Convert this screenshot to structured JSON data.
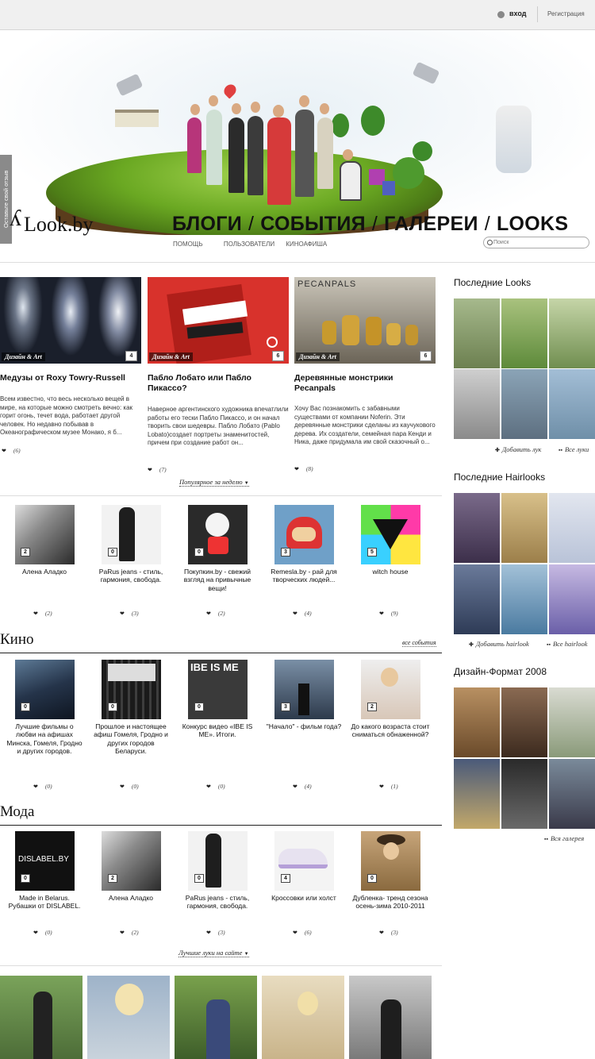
{
  "topbar": {
    "login": "вход",
    "register": "Регистрация"
  },
  "feedback": "Оставьте свой отзыв",
  "logo": "Look.by",
  "nav": {
    "items": [
      "БЛОГИ",
      "СОБЫТИЯ",
      "ГАЛЕРЕИ",
      "LOOKS"
    ],
    "sep": "/"
  },
  "subnav": [
    "ПОМОЩЬ",
    "ПОЛЬЗОВАТЕЛИ",
    "КИНОАФИША"
  ],
  "search": {
    "placeholder": "Поиск"
  },
  "articles": [
    {
      "category": "Дизайн & Art",
      "count": "4",
      "title": "Медузы от Roxy Towry-Russell",
      "text": "Всем известно, что весь несколько вещей в мире, на которые можно смотреть вечно: как горит огонь, течет вода, работает другой человек. Но недавно побывав в Океанографическом музее Монако, я б...",
      "likes": "(6)"
    },
    {
      "category": "Дизайн & Art",
      "count": "6",
      "title": "Пабло Лобато или Пабло Пикассо?",
      "text": "Наверное аргентинского художника впечатлили работы его тески Пабло Пикассо, и он начал творить свои шедевры. Пабло Лобато (Pablo Lobato)создает портреты знаменитостей, причем при создание работ он...",
      "likes": "(7)"
    },
    {
      "category": "Дизайн & Art",
      "count": "6",
      "title": "Деревянные монстрики Pecanpals",
      "text": "Хочу Вас познакомить с забавными существами от компании Noferin. Эти деревянные монстрики сделаны из каучукового дерева. Их создатели, семейная пара Кенди и Ника, даже придумала им свой сказочный о...",
      "likes": "(8)"
    }
  ],
  "popular_link": "Популярное за неделю",
  "blogs": [
    {
      "label": "Алена Аладко",
      "count": "2",
      "likes": "(2)"
    },
    {
      "label": "PaRus jeans - стиль, гармония, свобода.",
      "count": "0",
      "likes": "(3)"
    },
    {
      "label": "Покупкин.by - свежий взгляд на привычные вещи!",
      "count": "0",
      "likes": "(2)"
    },
    {
      "label": "Remesla.by - рай для творческих людей...",
      "count": "3",
      "likes": "(4)"
    },
    {
      "label": "witch house",
      "count": "5",
      "likes": "(9)"
    }
  ],
  "kino": {
    "title": "Кино",
    "link": "все события",
    "items": [
      {
        "label": "Лучшие фильмы о любви на афишах Минска, Гомеля, Гродно и других городов.",
        "count": "0",
        "likes": "(0)"
      },
      {
        "label": "Прошлое и настоящее афиш Гомеля, Гродно и других городов Беларуси.",
        "count": "0",
        "likes": "(0)"
      },
      {
        "label": "Конкурс видео «IBE IS ME». Итоги.",
        "count": "0",
        "likes": "(0)",
        "img_text": "IBE IS ME"
      },
      {
        "label": "\"Начало\" - фильм года?",
        "count": "3",
        "likes": "(4)"
      },
      {
        "label": "До какого возраста стоит сниматься обнаженной?",
        "count": "2",
        "likes": "(1)"
      }
    ]
  },
  "moda": {
    "title": "Мода",
    "items": [
      {
        "label": "Made in Belarus. Рубашки от DISLABEL.",
        "count": "0",
        "likes": "(0)",
        "img_text": "DISLABEL.BY"
      },
      {
        "label": "Алена Аладко",
        "count": "2",
        "likes": "(2)"
      },
      {
        "label": "PaRus jeans - стиль, гармония, свобода.",
        "count": "0",
        "likes": "(3)"
      },
      {
        "label": "Кроссовки или холст",
        "count": "4",
        "likes": "(6)"
      },
      {
        "label": "Дубленка- тренд сезона осень-зима 2010-2011",
        "count": "0",
        "likes": "(3)"
      }
    ]
  },
  "best_looks_link": "Лучшие луки на сайте",
  "sidebar": {
    "looks": {
      "title": "Последние Looks",
      "add": "Добавить лук",
      "all": "Все луки"
    },
    "hairlooks": {
      "title": "Последние Hairlooks",
      "add": "Добавить hairlook",
      "all": "Все hairlook"
    },
    "design": {
      "title": "Дизайн-Формат 2008",
      "all": "Вся галерея"
    }
  },
  "icons": {
    "heart": "heart-icon",
    "add": "plus-icon",
    "all": "grid-icon"
  },
  "colors": {
    "accent": "#222222",
    "topbar": "#f0f0f0",
    "badge_bg": "#555555"
  }
}
